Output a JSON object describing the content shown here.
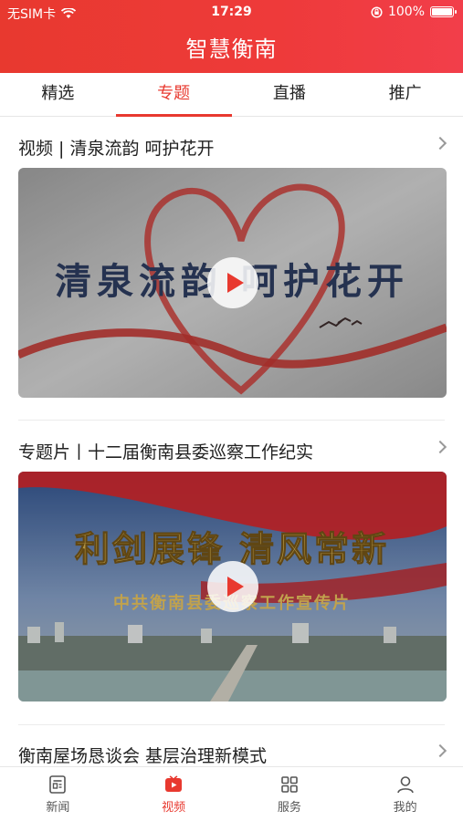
{
  "status_bar": {
    "carrier": "无SIM卡",
    "time": "17:29",
    "battery": "100%"
  },
  "app": {
    "title": "智慧衡南"
  },
  "tabs": [
    {
      "label": "精选"
    },
    {
      "label": "专题",
      "active": true
    },
    {
      "label": "直播"
    },
    {
      "label": "推广"
    }
  ],
  "feed": {
    "items": [
      {
        "title": "视频 | 清泉流韵  呵护花开",
        "video_caption": "清泉流韵 呵护花开"
      },
      {
        "title": "专题片丨十二届衡南县委巡察工作纪实",
        "video_caption": "利剑展锋  清风常新",
        "video_subcaption": "中共衡南县委巡察工作宣传片"
      },
      {
        "title": "衡南屋场恳谈会  基层治理新模式"
      }
    ]
  },
  "bottom_nav": [
    {
      "label": "新闻",
      "icon": "news-icon"
    },
    {
      "label": "视频",
      "icon": "video-icon",
      "active": true
    },
    {
      "label": "服务",
      "icon": "grid-icon"
    },
    {
      "label": "我的",
      "icon": "user-icon"
    }
  ],
  "colors": {
    "accent": "#e8392f"
  }
}
